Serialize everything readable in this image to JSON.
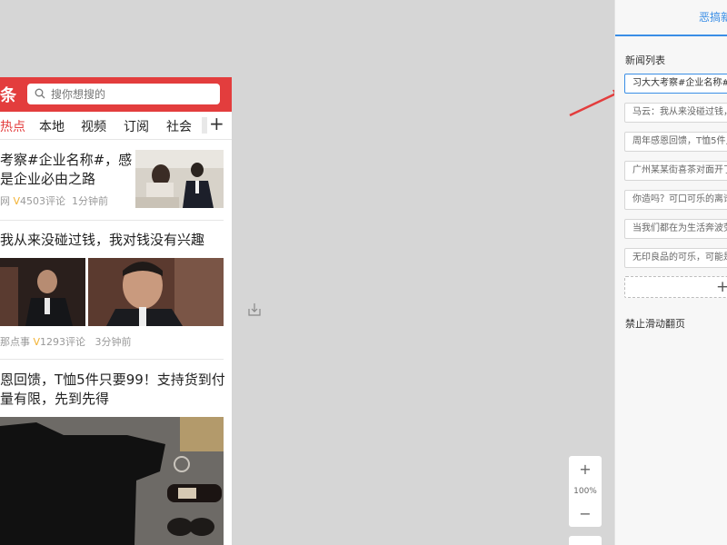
{
  "phone": {
    "brand_partial": "条",
    "search_placeholder": "搜你想搜的",
    "tabs": [
      "热点",
      "本地",
      "视频",
      "订阅",
      "社会"
    ],
    "tab_plus": "+",
    "articles": [
      {
        "title_line1": "考察#企业名称#，感",
        "title_line2": "是企业必由之路",
        "meta_source": "网",
        "meta_v": "V",
        "meta_comments": "4503评论",
        "meta_time": "1分钟前"
      },
      {
        "title_line1": "我从来没碰过钱，我对钱没有兴趣",
        "meta_source": "那点事",
        "meta_v": "V",
        "meta_comments": "1293评论",
        "meta_time": "3分钟前"
      },
      {
        "title_line1": "恩回馈，T恤5件只要99！支持货到付",
        "title_line2": "量有限，先到先得"
      }
    ]
  },
  "panel": {
    "title": "恶搞新",
    "section_label": "新闻列表",
    "news_items": [
      "习大大考察#企业名称#，",
      "马云：我从来没碰过钱，",
      "周年感恩回馈，T恤5件只",
      "广州某某街喜茶对面开了",
      "你造吗？可口可乐的离谱",
      "当我们都在为生活奔波劳",
      "无印良品的可乐，可能是"
    ],
    "add_label": "+",
    "disable_swipe": "禁止滑动翻页"
  },
  "zoom": {
    "plus": "+",
    "level": "100%",
    "minus": "−"
  },
  "colors": {
    "brand_red": "#e33d3d",
    "accent_blue": "#3a8ee6",
    "annotation_arrow": "#e33d3d"
  }
}
